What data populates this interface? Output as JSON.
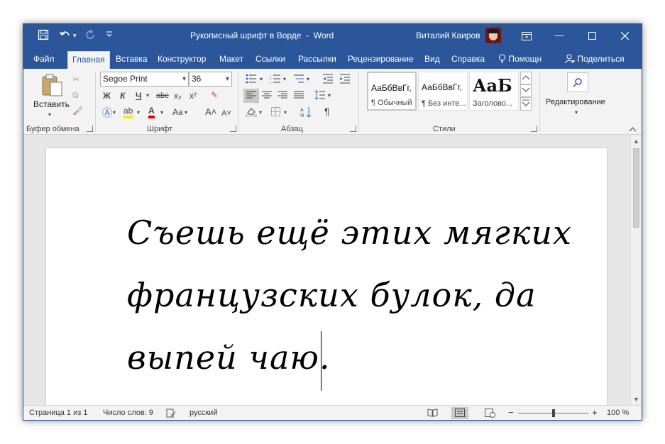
{
  "window": {
    "title": "Рукописный шрифт в Ворде  -  Word",
    "user_name": "Виталий Каиров",
    "buttons": {
      "ribbon_display": "⊡",
      "minimize": "—",
      "maximize": "☐",
      "close": "✕"
    }
  },
  "qat": {
    "save_icon": "💾",
    "undo_icon": "↶",
    "undo_arrow": "▾",
    "redo_icon": "↻",
    "customize_icon": "⩡"
  },
  "tabs": [
    {
      "label": "Файл"
    },
    {
      "label": "Главная"
    },
    {
      "label": "Вставка"
    },
    {
      "label": "Конструктор"
    },
    {
      "label": "Макет"
    },
    {
      "label": "Ссылки"
    },
    {
      "label": "Рассылки"
    },
    {
      "label": "Рецензирование"
    },
    {
      "label": "Вид"
    },
    {
      "label": "Справка"
    },
    {
      "label": "Помощн"
    },
    {
      "label": "Поделиться"
    }
  ],
  "ribbon": {
    "clipboard": {
      "label": "Буфер обмена",
      "paste_label": "Вставить"
    },
    "font": {
      "label": "Шрифт",
      "font_name": "Segoe Print",
      "font_size": "36",
      "bold": "Ж",
      "italic": "К",
      "underline": "Ч",
      "strike": "abc",
      "subscript": "x₂",
      "superscript": "x²",
      "change_case": "Aa",
      "grow": "A˄",
      "shrink": "A˅"
    },
    "paragraph": {
      "label": "Абзац"
    },
    "styles": {
      "label": "Стили",
      "items": [
        {
          "sample": "АаБбВвГг,",
          "name": "¶ Обычный"
        },
        {
          "sample": "АаБбВвГг,",
          "name": "¶ Без инте..."
        },
        {
          "sample": "АаБ",
          "name": "Заголово..."
        }
      ]
    },
    "editing": {
      "label": "Редактирование"
    }
  },
  "document": {
    "lines": [
      "Съешь ещё этих мягких",
      "французских булок, да",
      "выпей чаю."
    ]
  },
  "status": {
    "page": "Страница 1 из 1",
    "words": "Число слов: 9",
    "language": "русский",
    "zoom": "100 %",
    "zoom_minus": "−",
    "zoom_plus": "+"
  },
  "colors": {
    "accent": "#2b579a",
    "ribbon": "#f3f3f3",
    "canvas": "#e6e6e6"
  }
}
